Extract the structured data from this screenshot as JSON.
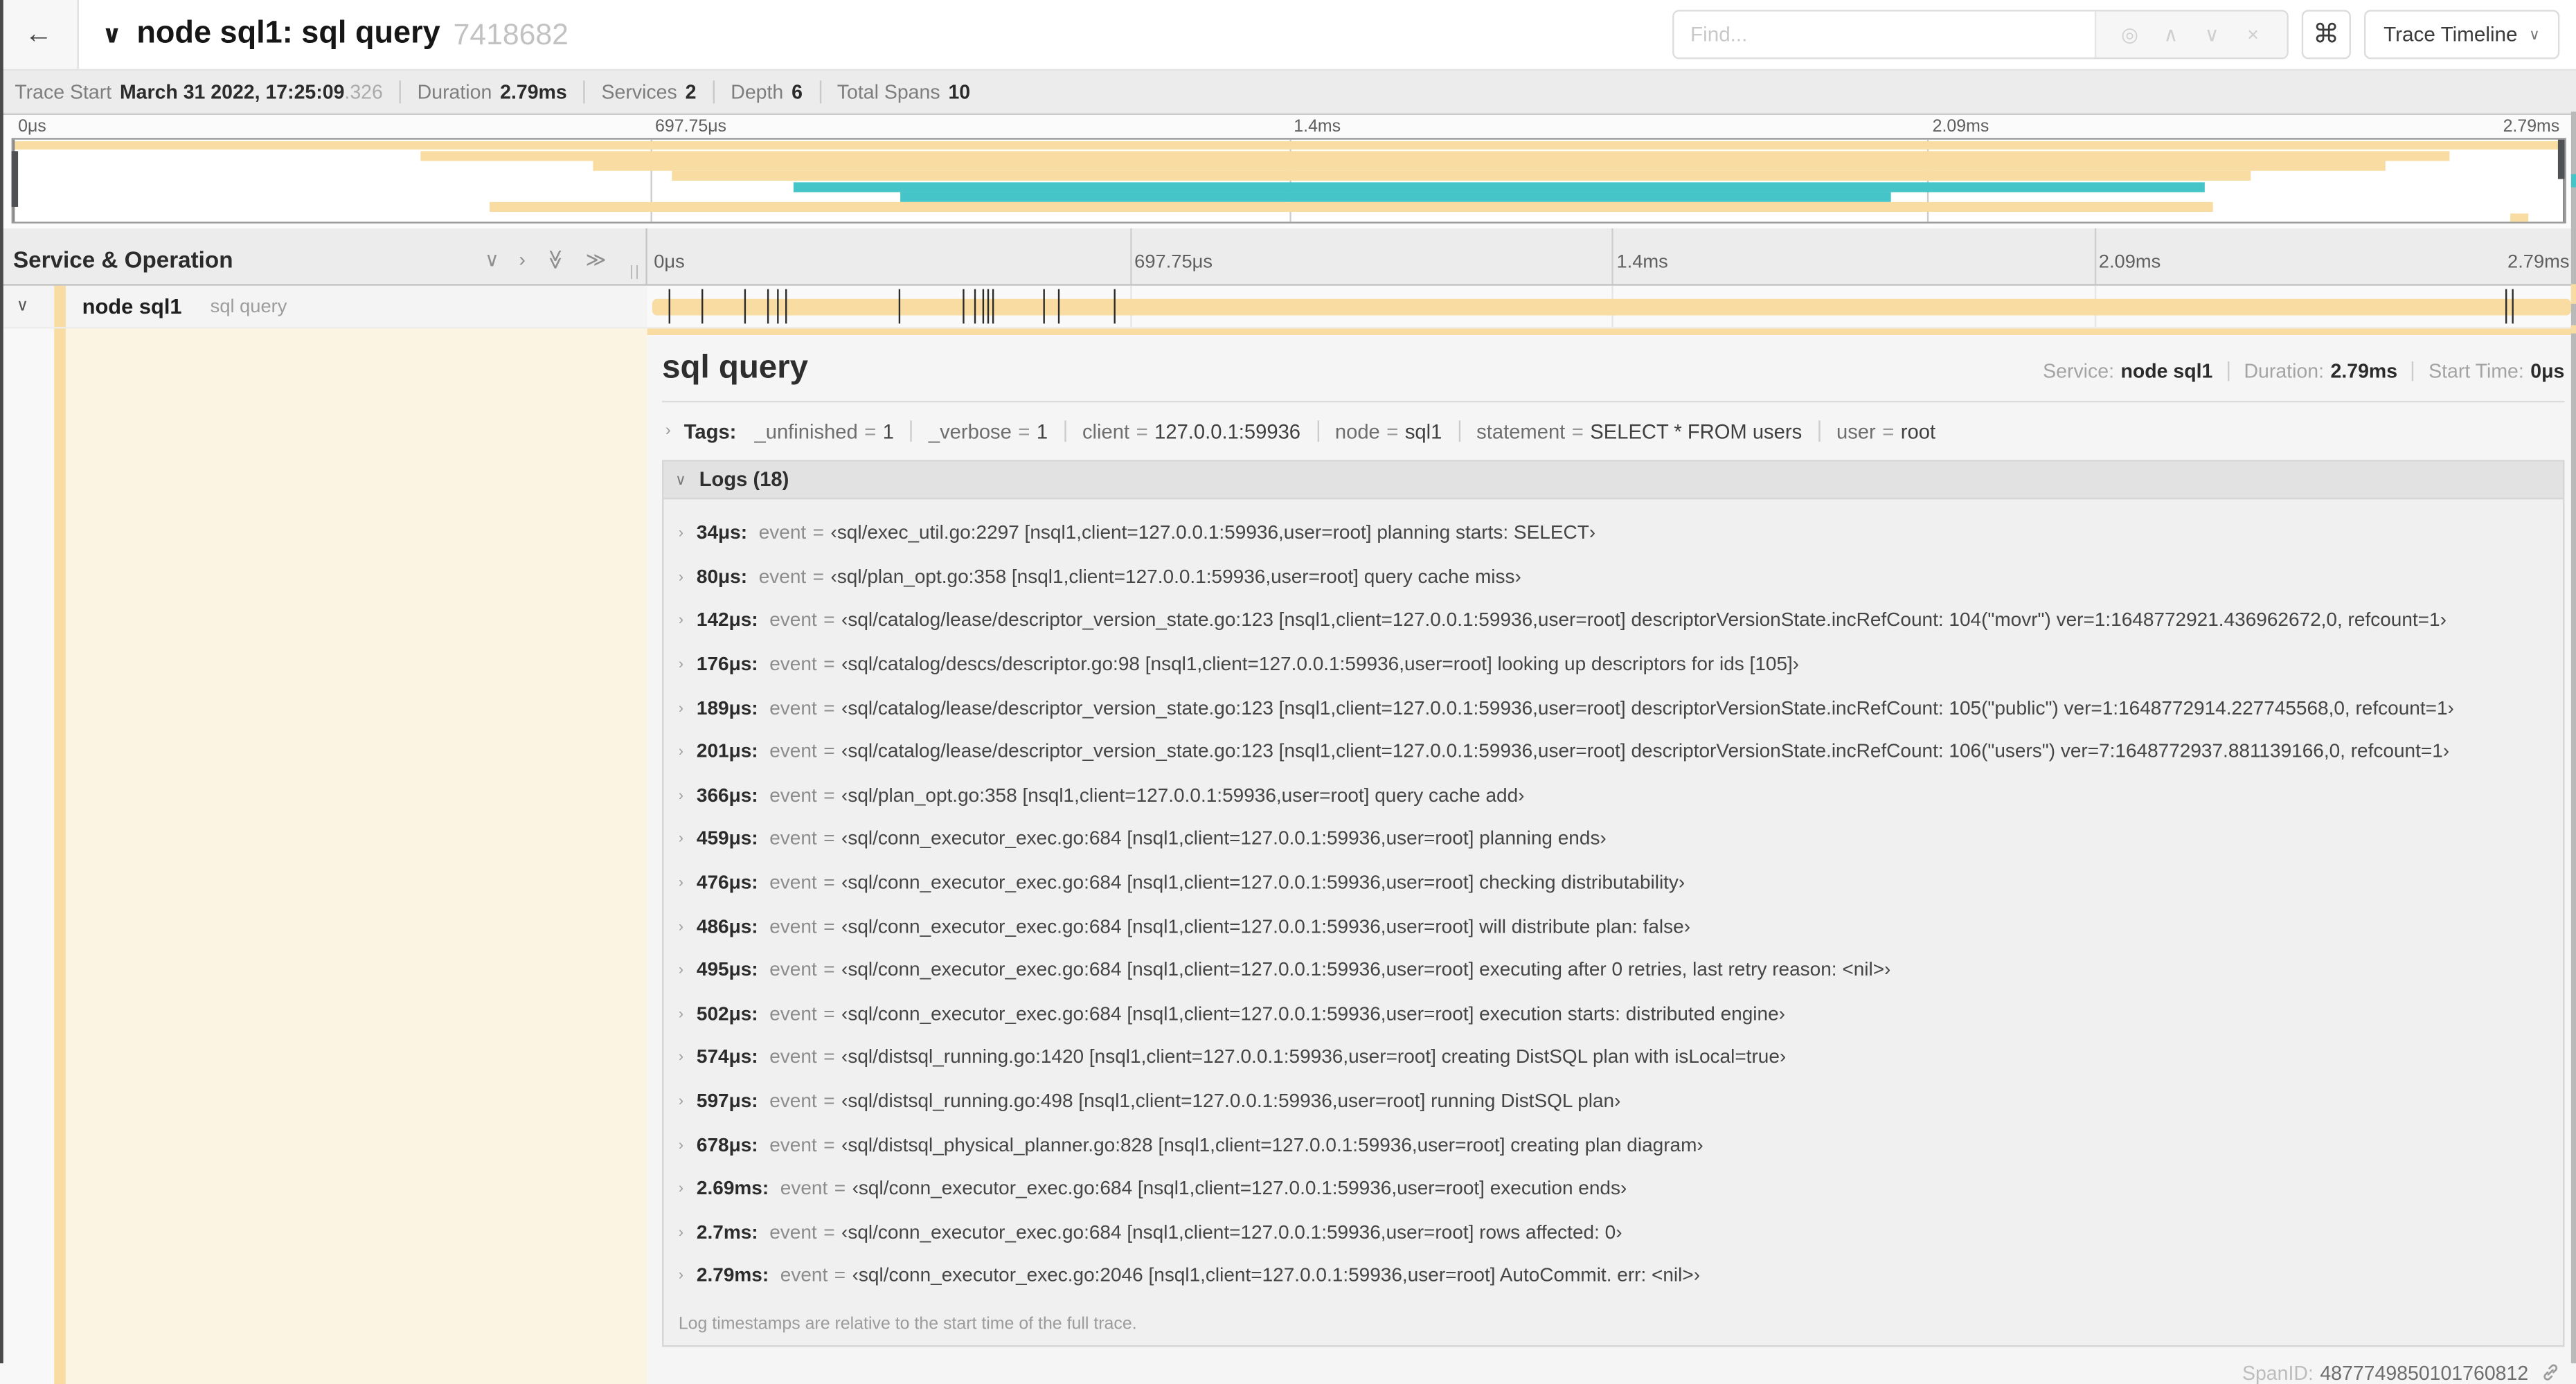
{
  "header": {
    "back_icon": "←",
    "collapse_chevron": "∨",
    "title": "node sql1: sql query",
    "trace_id": "7418682",
    "find_placeholder": "Find...",
    "find_icons": [
      {
        "name": "locate-icon",
        "glyph": "◎"
      },
      {
        "name": "prev-result-icon",
        "glyph": "∧"
      },
      {
        "name": "next-result-icon",
        "glyph": "∨"
      },
      {
        "name": "clear-search-icon",
        "glyph": "×"
      }
    ],
    "shortcut_label": "⌘",
    "view_button": "Trace Timeline",
    "view_button_caret": "∨"
  },
  "trace_info": [
    {
      "label": "Trace Start",
      "value": "March 31 2022, 17:25:09",
      "suffix": ".326"
    },
    {
      "label": "Duration",
      "value": "2.79ms",
      "suffix": ""
    },
    {
      "label": "Services",
      "value": "2",
      "suffix": ""
    },
    {
      "label": "Depth",
      "value": "6",
      "suffix": ""
    },
    {
      "label": "Total Spans",
      "value": "10",
      "suffix": ""
    }
  ],
  "timeline": {
    "duration_us": 2790,
    "tick_labels": [
      "0μs",
      "697.75μs",
      "1.4ms",
      "2.09ms",
      "2.79ms"
    ],
    "tick_fractions": [
      0,
      0.25,
      0.5,
      0.75,
      1
    ],
    "minimap_bars": [
      {
        "row": 0,
        "start": 0,
        "end": 100,
        "color": "tan"
      },
      {
        "row": 1,
        "start": 16,
        "end": 95.5,
        "color": "tan"
      },
      {
        "row": 2,
        "start": 22.7,
        "end": 93,
        "color": "tan"
      },
      {
        "row": 3,
        "start": 25.8,
        "end": 87.7,
        "color": "tan"
      },
      {
        "row": 4,
        "start": 30.6,
        "end": 85.9,
        "color": "teal"
      },
      {
        "row": 5,
        "start": 34.8,
        "end": 73.6,
        "color": "teal"
      },
      {
        "row": 6,
        "start": 18.7,
        "end": 86.2,
        "color": "tan"
      },
      {
        "row": 7,
        "start": 97.9,
        "end": 98.6,
        "color": "tan"
      }
    ]
  },
  "span_tree": {
    "header_label": "Service & Operation",
    "icons": [
      {
        "name": "collapse-one-icon",
        "glyph": "∨",
        "rotate": false
      },
      {
        "name": "expand-one-icon",
        "glyph": "›",
        "rotate": false
      },
      {
        "name": "collapse-all-icon",
        "glyph": "≫",
        "rotate": true
      },
      {
        "name": "expand-all-icon",
        "glyph": "≫",
        "rotate": false
      }
    ],
    "grip": "||",
    "row": {
      "chevron": "∨",
      "service": "node sql1",
      "operation": "sql query"
    }
  },
  "detail": {
    "title": "sql query",
    "meta": [
      {
        "label": "Service:",
        "value": "node sql1"
      },
      {
        "label": "Duration:",
        "value": "2.79ms"
      },
      {
        "label": "Start Time:",
        "value": "0μs"
      }
    ],
    "tags_label": "Tags:",
    "tags": [
      {
        "key": "_unfinished",
        "value": "1"
      },
      {
        "key": "_verbose",
        "value": "1"
      },
      {
        "key": "client",
        "value": "127.0.0.1:59936"
      },
      {
        "key": "node",
        "value": "sql1"
      },
      {
        "key": "statement",
        "value": "SELECT * FROM users"
      },
      {
        "key": "user",
        "value": "root"
      }
    ],
    "logs_label": "Logs (18)",
    "log_key": "event",
    "logs": [
      {
        "time": "34μs",
        "us": 34,
        "event": "sql/exec_util.go:2297 [nsql1,client=127.0.0.1:59936,user=root] planning starts: SELECT"
      },
      {
        "time": "80μs",
        "us": 80,
        "event": "sql/plan_opt.go:358 [nsql1,client=127.0.0.1:59936,user=root] query cache miss"
      },
      {
        "time": "142μs",
        "us": 142,
        "event": "sql/catalog/lease/descriptor_version_state.go:123 [nsql1,client=127.0.0.1:59936,user=root] descriptorVersionState.incRefCount: 104(\"movr\") ver=1:1648772921.436962672,0, refcount=1"
      },
      {
        "time": "176μs",
        "us": 176,
        "event": "sql/catalog/descs/descriptor.go:98 [nsql1,client=127.0.0.1:59936,user=root] looking up descriptors for ids [105]"
      },
      {
        "time": "189μs",
        "us": 189,
        "event": "sql/catalog/lease/descriptor_version_state.go:123 [nsql1,client=127.0.0.1:59936,user=root] descriptorVersionState.incRefCount: 105(\"public\") ver=1:1648772914.227745568,0, refcount=1"
      },
      {
        "time": "201μs",
        "us": 201,
        "event": "sql/catalog/lease/descriptor_version_state.go:123 [nsql1,client=127.0.0.1:59936,user=root] descriptorVersionState.incRefCount: 106(\"users\") ver=7:1648772937.881139166,0, refcount=1"
      },
      {
        "time": "366μs",
        "us": 366,
        "event": "sql/plan_opt.go:358 [nsql1,client=127.0.0.1:59936,user=root] query cache add"
      },
      {
        "time": "459μs",
        "us": 459,
        "event": "sql/conn_executor_exec.go:684 [nsql1,client=127.0.0.1:59936,user=root] planning ends"
      },
      {
        "time": "476μs",
        "us": 476,
        "event": "sql/conn_executor_exec.go:684 [nsql1,client=127.0.0.1:59936,user=root] checking distributability"
      },
      {
        "time": "486μs",
        "us": 486,
        "event": "sql/conn_executor_exec.go:684 [nsql1,client=127.0.0.1:59936,user=root] will distribute plan: false"
      },
      {
        "time": "495μs",
        "us": 495,
        "event": "sql/conn_executor_exec.go:684 [nsql1,client=127.0.0.1:59936,user=root] executing after 0 retries, last retry reason: <nil>"
      },
      {
        "time": "502μs",
        "us": 502,
        "event": "sql/conn_executor_exec.go:684 [nsql1,client=127.0.0.1:59936,user=root] execution starts: distributed engine"
      },
      {
        "time": "574μs",
        "us": 574,
        "event": "sql/distsql_running.go:1420 [nsql1,client=127.0.0.1:59936,user=root] creating DistSQL plan with isLocal=true"
      },
      {
        "time": "597μs",
        "us": 597,
        "event": "sql/distsql_running.go:498 [nsql1,client=127.0.0.1:59936,user=root] running DistSQL plan"
      },
      {
        "time": "678μs",
        "us": 678,
        "event": "sql/distsql_physical_planner.go:828 [nsql1,client=127.0.0.1:59936,user=root] creating plan diagram"
      },
      {
        "time": "2.69ms",
        "us": 2690,
        "event": "sql/conn_executor_exec.go:684 [nsql1,client=127.0.0.1:59936,user=root] execution ends"
      },
      {
        "time": "2.7ms",
        "us": 2700,
        "event": "sql/conn_executor_exec.go:684 [nsql1,client=127.0.0.1:59936,user=root] rows affected: 0"
      },
      {
        "time": "2.79ms",
        "us": 2790,
        "event": "sql/conn_executor_exec.go:2046 [nsql1,client=127.0.0.1:59936,user=root] AutoCommit. err: <nil>"
      }
    ],
    "logs_note": "Log timestamps are relative to the start time of the full trace.",
    "span_id_label": "SpanID:",
    "span_id": "4877749850101760812"
  },
  "colors": {
    "tan": "#F8DCA1",
    "teal": "#45C5C8",
    "cream": "#FBF4E2"
  }
}
